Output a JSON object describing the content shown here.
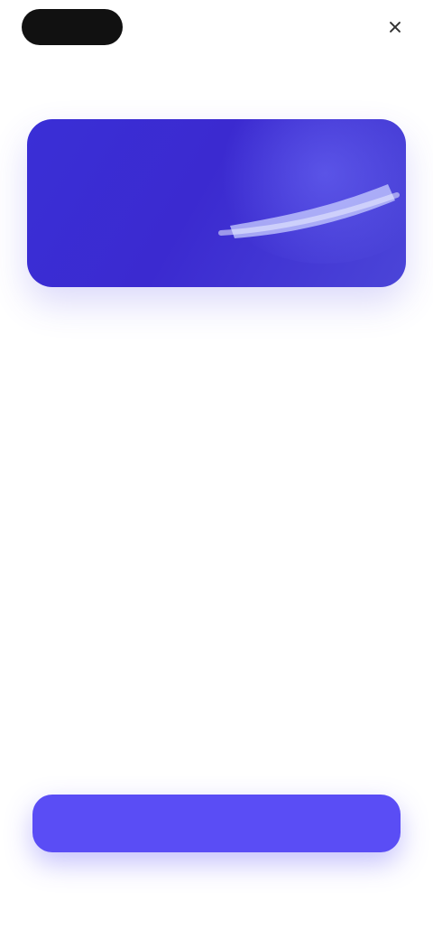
{
  "header": {
    "brand": "",
    "skip_label": ""
  },
  "hero": {
    "accent_color": "#3b2ad0"
  },
  "content": {
    "title": "",
    "paragraph_1": "",
    "paragraph_2": "",
    "note_text": "",
    "note_link": ""
  },
  "cta": {
    "label": "",
    "color": "#5a4df5"
  },
  "footer": {
    "text": ""
  }
}
